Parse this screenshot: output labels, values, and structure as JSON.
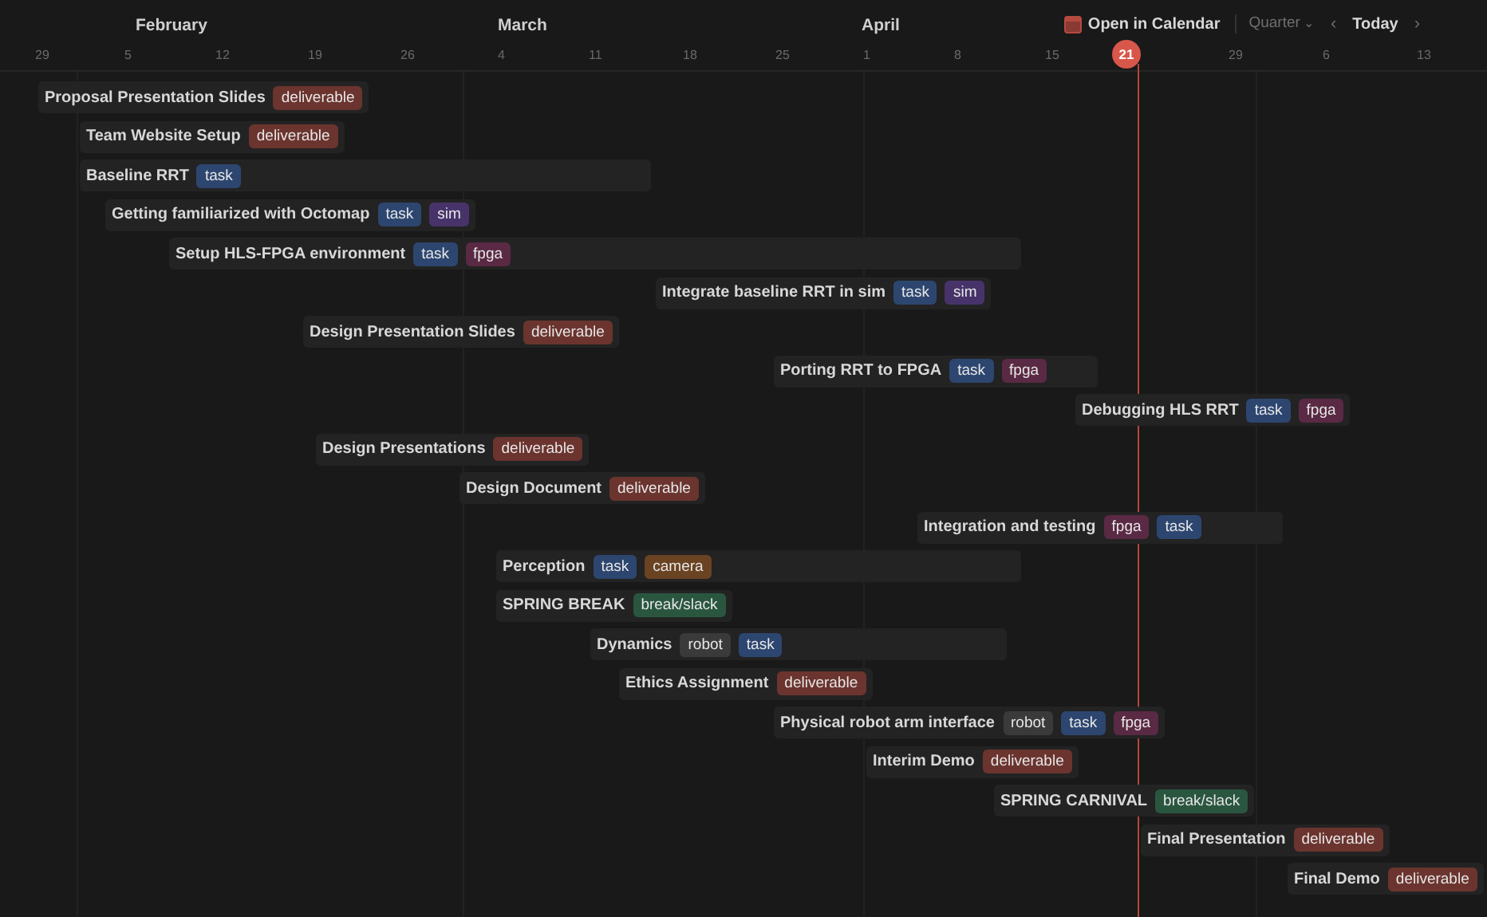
{
  "months": [
    "February",
    "March",
    "April"
  ],
  "weeks": [
    "29",
    "5",
    "12",
    "19",
    "26",
    "4",
    "11",
    "18",
    "25",
    "1",
    "8",
    "15",
    "29",
    "6",
    "13"
  ],
  "today_marker": "21",
  "toolbar": {
    "open_calendar": "Open in Calendar",
    "range": "Quarter",
    "range_caret": "⌄",
    "prev": "‹",
    "today": "Today",
    "next": "›"
  },
  "items": [
    {
      "title": "Proposal Presentation Slides",
      "tags": [
        {
          "label": "deliverable",
          "color": "#6b342e"
        }
      ]
    },
    {
      "title": "Team Website Setup",
      "tags": [
        {
          "label": "deliverable",
          "color": "#6b342e"
        }
      ]
    },
    {
      "title": "Baseline RRT",
      "tags": [
        {
          "label": "task",
          "color": "#2d4670"
        }
      ]
    },
    {
      "title": "Getting familiarized with Octomap",
      "tags": [
        {
          "label": "task",
          "color": "#2d4670"
        },
        {
          "label": "sim",
          "color": "#47336a"
        }
      ]
    },
    {
      "title": "Setup HLS-FPGA environment",
      "tags": [
        {
          "label": "task",
          "color": "#2d4670"
        },
        {
          "label": "fpga",
          "color": "#5a2943"
        }
      ]
    },
    {
      "title": "Integrate baseline RRT in sim",
      "tags": [
        {
          "label": "task",
          "color": "#2d4670"
        },
        {
          "label": "sim",
          "color": "#47336a"
        }
      ]
    },
    {
      "title": "Design Presentation Slides",
      "tags": [
        {
          "label": "deliverable",
          "color": "#6b342e"
        }
      ]
    },
    {
      "title": "Porting RRT to FPGA",
      "tags": [
        {
          "label": "task",
          "color": "#2d4670"
        },
        {
          "label": "fpga",
          "color": "#5a2943"
        }
      ]
    },
    {
      "title": "Debugging HLS RRT",
      "tags": [
        {
          "label": "task",
          "color": "#2d4670"
        },
        {
          "label": "fpga",
          "color": "#5a2943"
        }
      ]
    },
    {
      "title": "Design Presentations",
      "tags": [
        {
          "label": "deliverable",
          "color": "#6b342e"
        }
      ]
    },
    {
      "title": "Design Document",
      "tags": [
        {
          "label": "deliverable",
          "color": "#6b342e"
        }
      ]
    },
    {
      "title": "Integration and testing",
      "tags": [
        {
          "label": "fpga",
          "color": "#5a2943"
        },
        {
          "label": "task",
          "color": "#2d4670"
        }
      ]
    },
    {
      "title": "Perception",
      "tags": [
        {
          "label": "task",
          "color": "#2d4670"
        },
        {
          "label": "camera",
          "color": "#6a4322"
        }
      ]
    },
    {
      "title": "SPRING BREAK",
      "tags": [
        {
          "label": "break/slack",
          "color": "#2a5640"
        }
      ]
    },
    {
      "title": "Dynamics",
      "tags": [
        {
          "label": "robot",
          "color": "#3a3a3a"
        },
        {
          "label": "task",
          "color": "#2d4670"
        }
      ]
    },
    {
      "title": "Ethics Assignment",
      "tags": [
        {
          "label": "deliverable",
          "color": "#6b342e"
        }
      ]
    },
    {
      "title": "Physical robot arm interface",
      "tags": [
        {
          "label": "robot",
          "color": "#3a3a3a"
        },
        {
          "label": "task",
          "color": "#2d4670"
        },
        {
          "label": "fpga",
          "color": "#5a2943"
        }
      ]
    },
    {
      "title": "Interim Demo",
      "tags": [
        {
          "label": "deliverable",
          "color": "#6b342e"
        }
      ]
    },
    {
      "title": "SPRING CARNIVAL",
      "tags": [
        {
          "label": "break/slack",
          "color": "#2a5640"
        }
      ]
    },
    {
      "title": "Final Presentation",
      "tags": [
        {
          "label": "deliverable",
          "color": "#6b342e"
        }
      ]
    },
    {
      "title": "Final Demo",
      "tags": [
        {
          "label": "deliverable",
          "color": "#6b342e"
        }
      ]
    }
  ]
}
